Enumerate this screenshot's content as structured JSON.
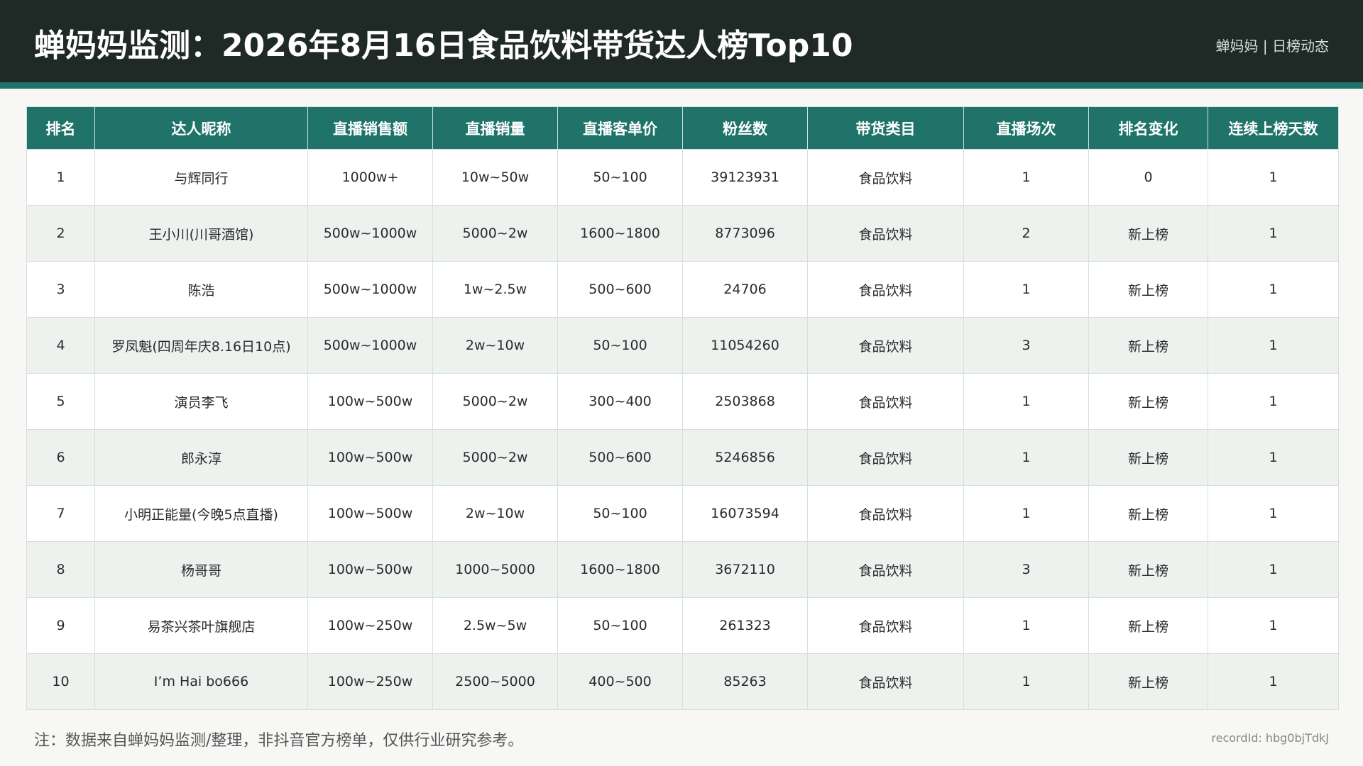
{
  "header": {
    "title": "蝉妈妈监测：2026年8月16日食品饮料带货达人榜Top10",
    "brand": "蝉妈妈 | 日榜动态"
  },
  "table": {
    "columns": [
      "排名",
      "达人昵称",
      "直播销售额",
      "直播销量",
      "直播客单价",
      "粉丝数",
      "带货类目",
      "直播场次",
      "排名变化",
      "连续上榜天数"
    ],
    "rows": [
      [
        "1",
        "与辉同行",
        "1000w+",
        "10w~50w",
        "50~100",
        "39123931",
        "食品饮料",
        "1",
        "0",
        "1"
      ],
      [
        "2",
        "王小川(川哥酒馆)",
        "500w~1000w",
        "5000~2w",
        "1600~1800",
        "8773096",
        "食品饮料",
        "2",
        "新上榜",
        "1"
      ],
      [
        "3",
        "陈浩",
        "500w~1000w",
        "1w~2.5w",
        "500~600",
        "24706",
        "食品饮料",
        "1",
        "新上榜",
        "1"
      ],
      [
        "4",
        "罗凤魁(四周年庆8.16日10点)",
        "500w~1000w",
        "2w~10w",
        "50~100",
        "11054260",
        "食品饮料",
        "3",
        "新上榜",
        "1"
      ],
      [
        "5",
        "演员李飞",
        "100w~500w",
        "5000~2w",
        "300~400",
        "2503868",
        "食品饮料",
        "1",
        "新上榜",
        "1"
      ],
      [
        "6",
        "郎永淳",
        "100w~500w",
        "5000~2w",
        "500~600",
        "5246856",
        "食品饮料",
        "1",
        "新上榜",
        "1"
      ],
      [
        "7",
        "小明正能量(今晚5点直播)",
        "100w~500w",
        "2w~10w",
        "50~100",
        "16073594",
        "食品饮料",
        "1",
        "新上榜",
        "1"
      ],
      [
        "8",
        "杨哥哥",
        "100w~500w",
        "1000~5000",
        "1600~1800",
        "3672110",
        "食品饮料",
        "3",
        "新上榜",
        "1"
      ],
      [
        "9",
        "易茶兴茶叶旗舰店",
        "100w~250w",
        "2.5w~5w",
        "50~100",
        "261323",
        "食品饮料",
        "1",
        "新上榜",
        "1"
      ],
      [
        "10",
        "I’m Hai bo666",
        "100w~250w",
        "2500~5000",
        "400~500",
        "85263",
        "食品饮料",
        "1",
        "新上榜",
        "1"
      ]
    ]
  },
  "footer": {
    "note": "注：数据来自蝉妈妈监测/整理，非抖音官方榜单，仅供行业研究参考。",
    "record_id": "recordId: hbg0bjTdkJ"
  },
  "colors": {
    "header_bg": "#1f2a27",
    "accent": "#1f7368",
    "alt_row": "#edf2ef"
  }
}
